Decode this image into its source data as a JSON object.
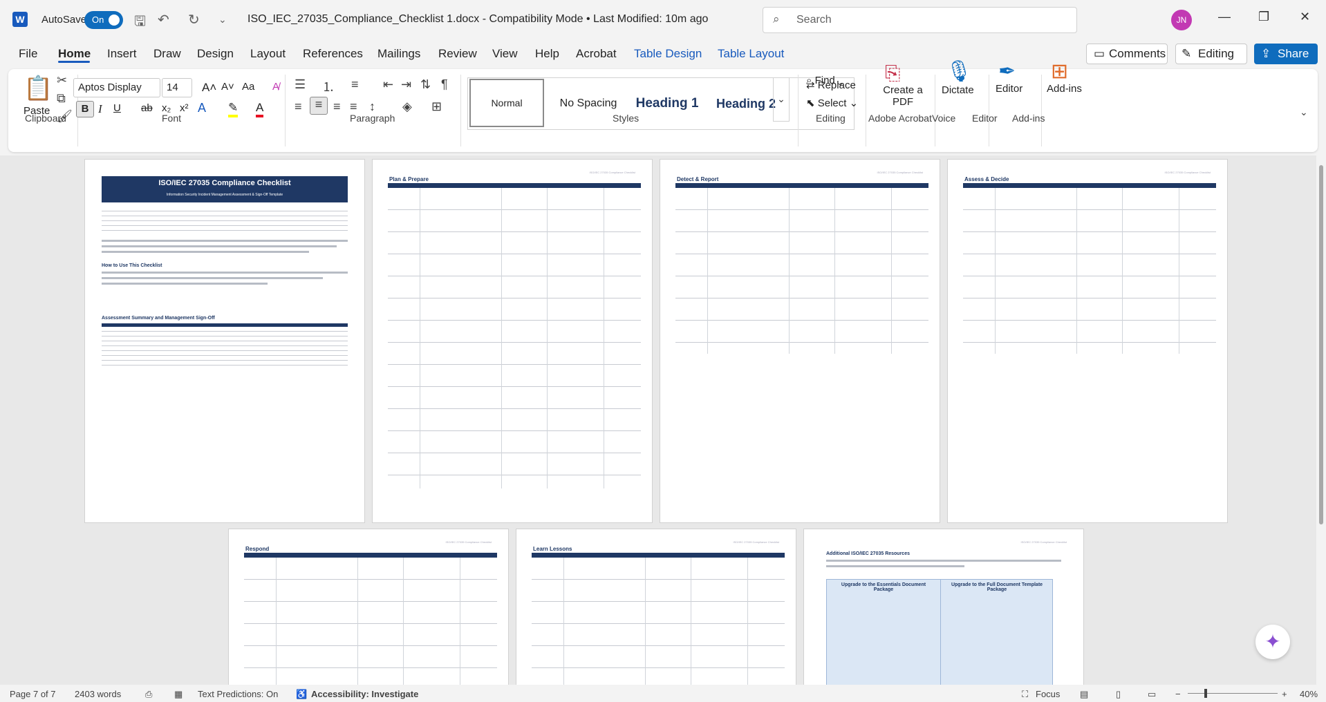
{
  "titlebar": {
    "autosave_label": "AutoSave",
    "autosave_state": "On",
    "doc_title": "ISO_IEC_27035_Compliance_Checklist 1.docx  -  Compatibility Mode  •  Last Modified: 10m ago",
    "search_placeholder": "Search",
    "avatar_initials": "JN"
  },
  "tabs": [
    "File",
    "Home",
    "Insert",
    "Draw",
    "Design",
    "Layout",
    "References",
    "Mailings",
    "Review",
    "View",
    "Help",
    "Acrobat",
    "Table Design",
    "Table Layout"
  ],
  "header_buttons": {
    "comments": "Comments",
    "editing": "Editing",
    "share": "Share"
  },
  "ribbon": {
    "clipboard": {
      "paste": "Paste",
      "label": "Clipboard"
    },
    "font": {
      "name": "Aptos Display",
      "size": "14",
      "label": "Font"
    },
    "paragraph": {
      "label": "Paragraph"
    },
    "styles": {
      "items": [
        "Normal",
        "No Spacing",
        "Heading 1",
        "Heading 2"
      ],
      "label": "Styles"
    },
    "editing": {
      "find": "Find",
      "replace": "Replace",
      "select": "Select",
      "label": "Editing"
    },
    "acrobat": {
      "create_pdf": "Create a PDF",
      "label": "Adobe Acrobat"
    },
    "voice": {
      "dictate": "Dictate",
      "label": "Voice"
    },
    "editor": {
      "editor": "Editor",
      "label": "Editor"
    },
    "addins": {
      "addins": "Add-ins",
      "label": "Add-ins"
    }
  },
  "pages": {
    "p1": {
      "title": "ISO/IEC 27035 Compliance Checklist",
      "subtitle": "Information Security Incident Management Assessment & Sign-Off Template",
      "h_how": "How to Use This Checklist",
      "h_summary": "Assessment Summary and Management Sign-Off"
    },
    "p2": {
      "title": "Plan & Prepare"
    },
    "p3": {
      "title": "Detect & Report"
    },
    "p4": {
      "title": "Assess & Decide"
    },
    "p5": {
      "title": "Respond"
    },
    "p6": {
      "title": "Learn Lessons"
    },
    "p7": {
      "title": "Additional ISO/IEC 27035 Resources",
      "box1": "Upgrade to the Essentials Document Package",
      "box2": "Upgrade to the Full Document Template Package"
    },
    "page_header": "ISO/IEC 27035 Compliance Checklist"
  },
  "status": {
    "page": "Page 7 of 7",
    "words": "2403 words",
    "predictions": "Text Predictions: On",
    "accessibility": "Accessibility: Investigate",
    "focus": "Focus",
    "zoom": "40%"
  }
}
